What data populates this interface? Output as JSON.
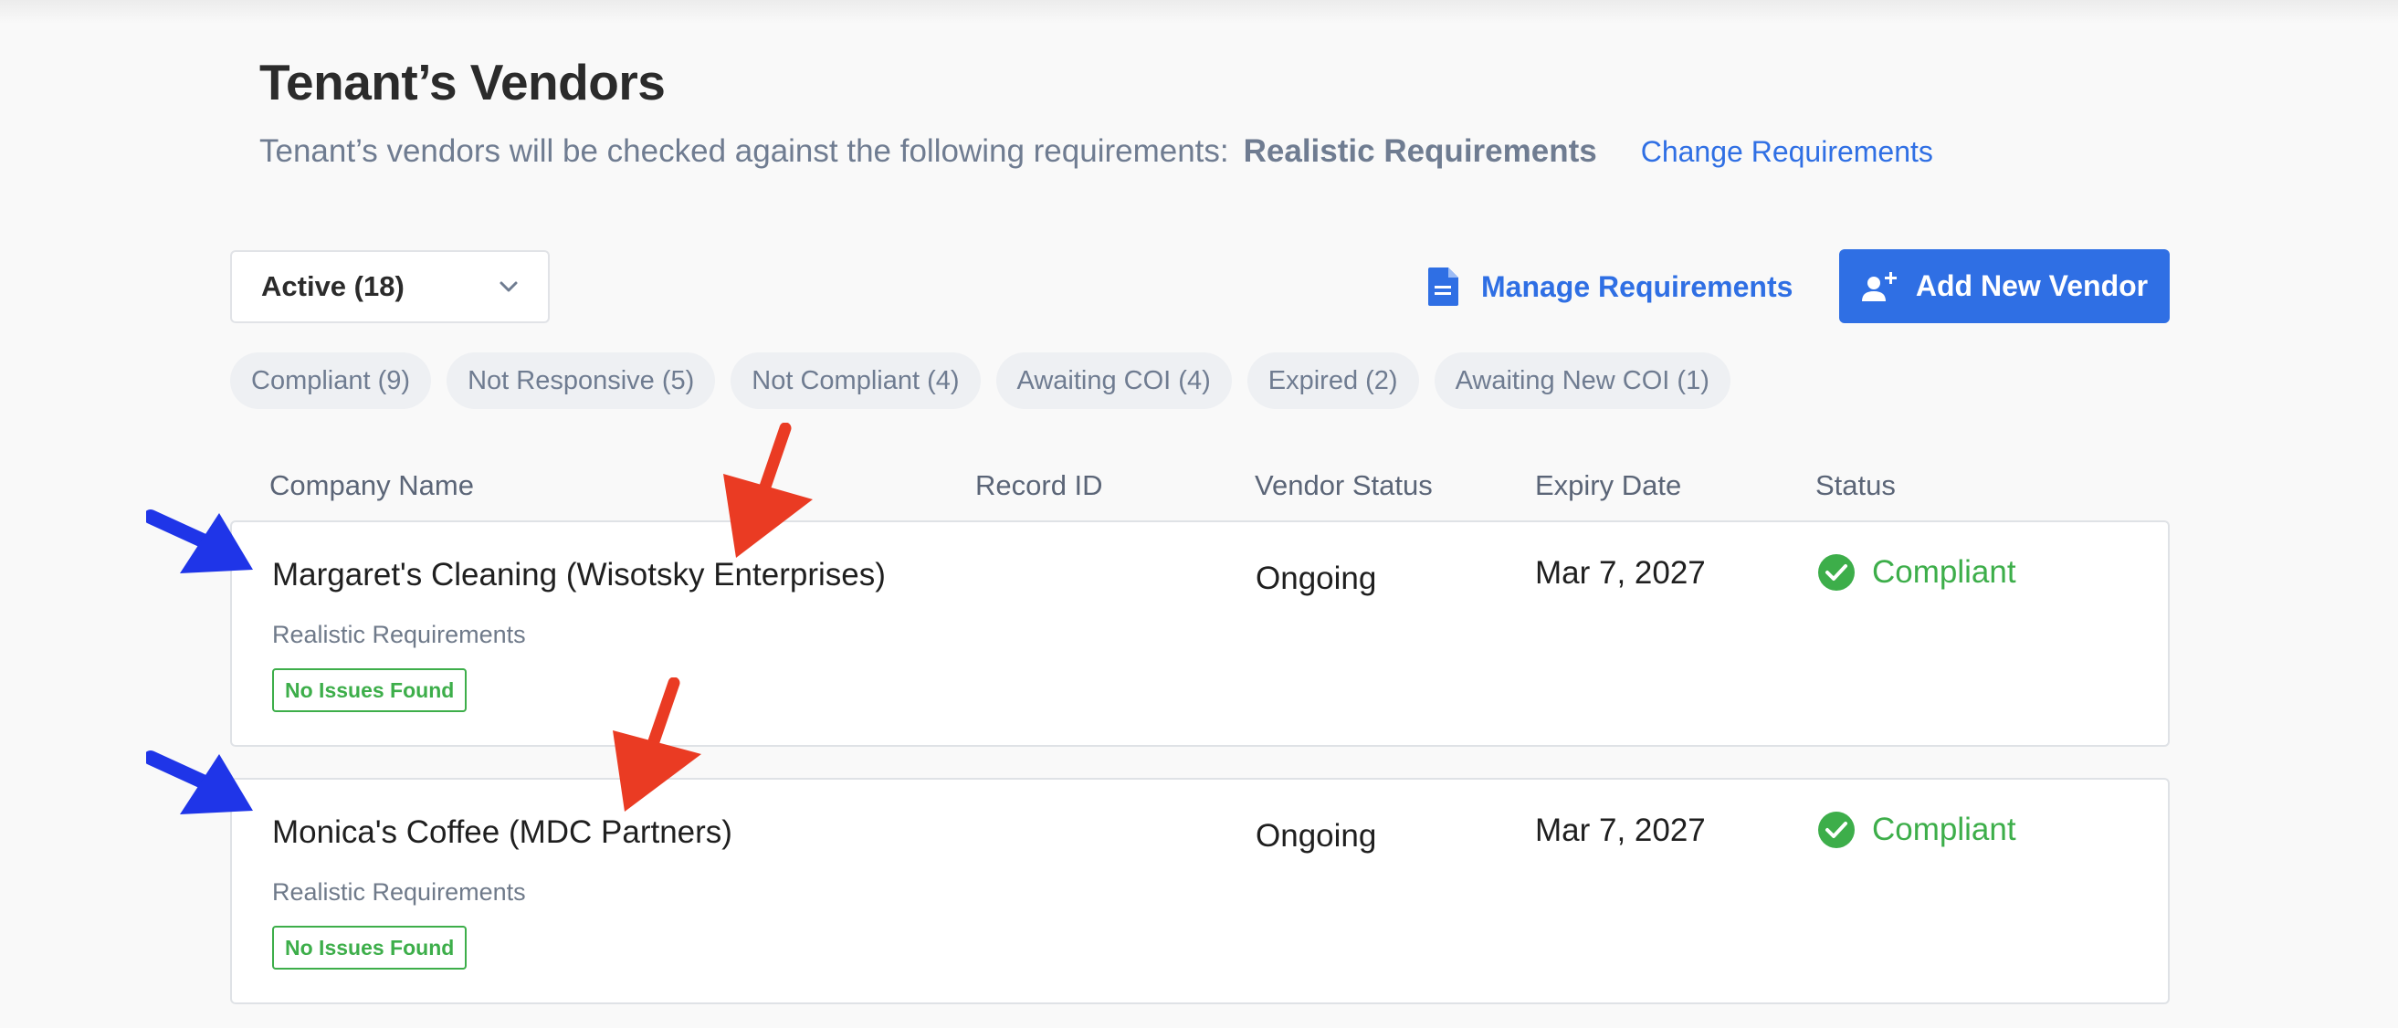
{
  "header": {
    "title": "Tenant’s Vendors",
    "subtitle": "Tenant’s vendors will be checked against the following requirements:",
    "requirement_name": "Realistic Requirements",
    "change_link": "Change Requirements"
  },
  "toolbar": {
    "status_select": {
      "selected": "Active (18)"
    },
    "manage_requirements": "Manage Requirements",
    "add_vendor": "Add New Vendor"
  },
  "filters": [
    "Compliant (9)",
    "Not Responsive (5)",
    "Not Compliant (4)",
    "Awaiting COI (4)",
    "Expired (2)",
    "Awaiting New COI (1)"
  ],
  "table": {
    "columns": [
      "Company Name",
      "Record ID",
      "Vendor Status",
      "Expiry Date",
      "Status"
    ],
    "rows": [
      {
        "company": "Margaret's Cleaning (Wisotsky Enterprises)",
        "requirements": "Realistic Requirements",
        "badge": "No Issues Found",
        "record_id": "",
        "vendor_status": "Ongoing",
        "expiry": "Mar 7, 2027",
        "status": "Compliant"
      },
      {
        "company": "Monica's Coffee (MDC Partners)",
        "requirements": "Realistic Requirements",
        "badge": "No Issues Found",
        "record_id": "",
        "vendor_status": "Ongoing",
        "expiry": "Mar 7, 2027",
        "status": "Compliant"
      }
    ]
  },
  "colors": {
    "accent": "#2f6fe4",
    "success": "#3dae4a",
    "annotation_blue": "#1f35e8",
    "annotation_red": "#ea3b23"
  },
  "icons": {
    "select": "chevron-down-icon",
    "manage_requirements": "document-icon",
    "add_vendor": "add-person-icon",
    "status": "check-circle-icon",
    "annotations": [
      "arrow-icon"
    ]
  }
}
